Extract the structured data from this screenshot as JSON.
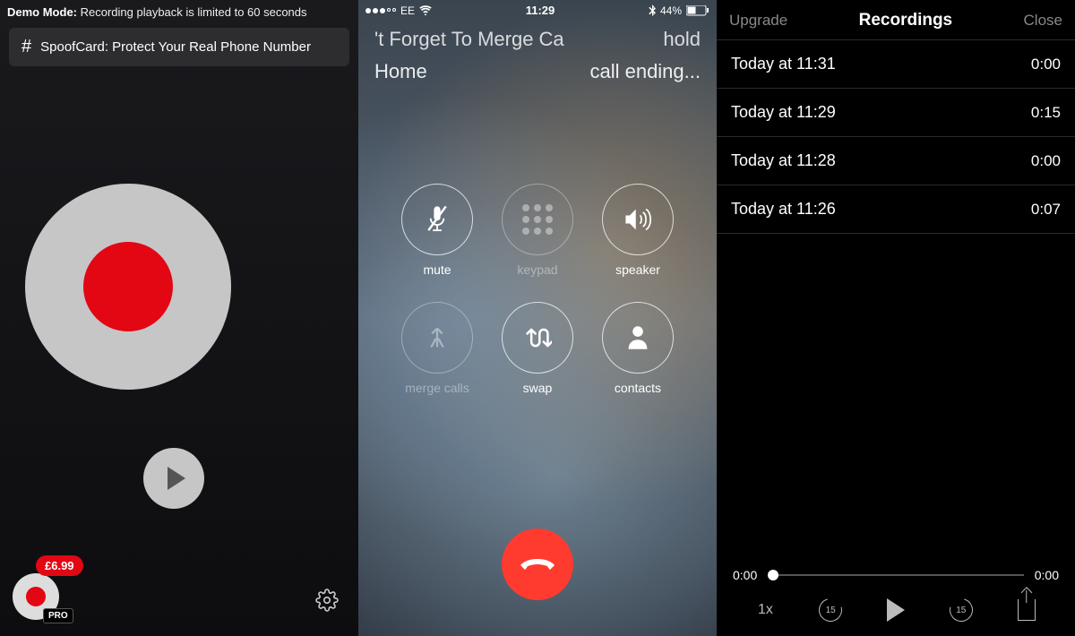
{
  "panel1": {
    "demo_prefix": "Demo Mode:",
    "demo_text": " Recording playback is limited to 60 seconds",
    "promo_text": "SpoofCard: Protect Your Real Phone Number",
    "price": "£6.99",
    "pro_label": "PRO"
  },
  "panel2": {
    "carrier": "EE",
    "time": "11:29",
    "battery": "44%",
    "call_name": "'t Forget To Merge Ca",
    "call_status": "hold",
    "secondary": "Home",
    "secondary_status": "call ending...",
    "buttons": {
      "mute": "mute",
      "keypad": "keypad",
      "speaker": "speaker",
      "merge": "merge calls",
      "swap": "swap",
      "contacts": "contacts"
    }
  },
  "panel3": {
    "upgrade": "Upgrade",
    "title": "Recordings",
    "close": "Close",
    "rows": [
      {
        "label": "Today at 11:31",
        "dur": "0:00"
      },
      {
        "label": "Today at 11:29",
        "dur": "0:15"
      },
      {
        "label": "Today at 11:28",
        "dur": "0:00"
      },
      {
        "label": "Today at 11:26",
        "dur": "0:07"
      }
    ],
    "playback": {
      "pos": "0:00",
      "total": "0:00",
      "speed": "1x",
      "skip": "15"
    }
  }
}
